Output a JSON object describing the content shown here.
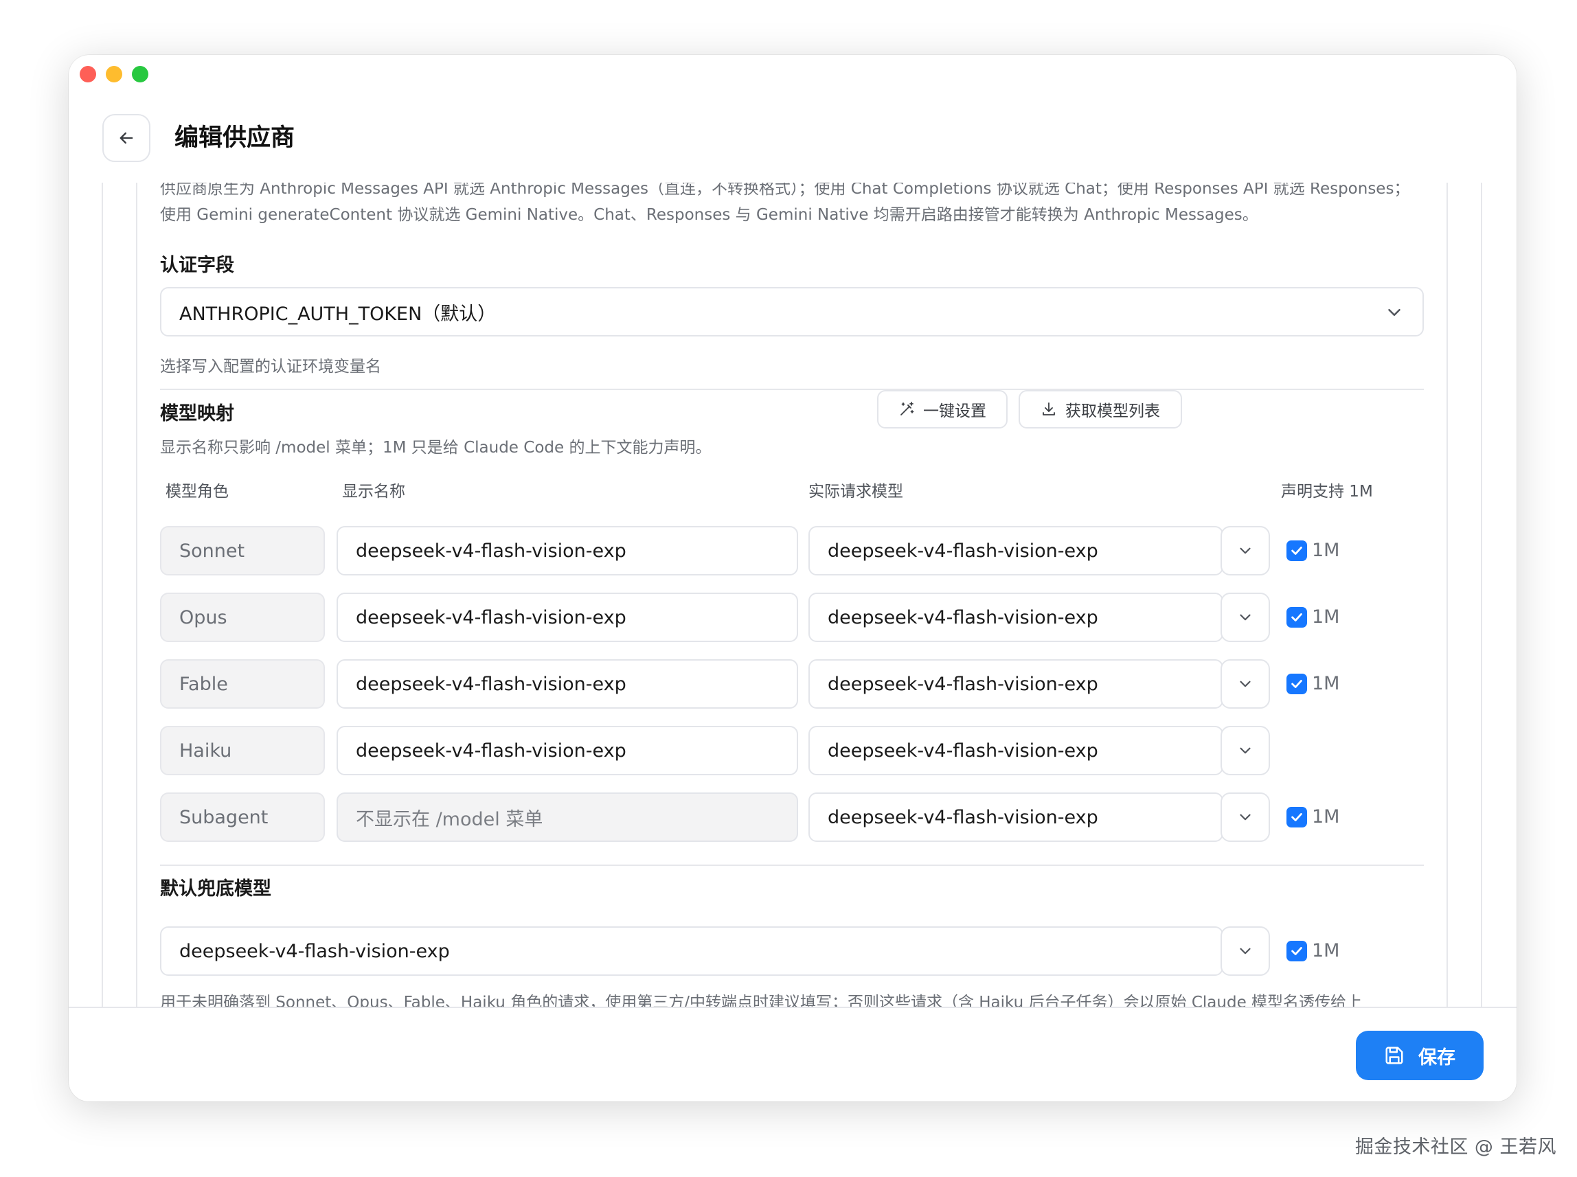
{
  "window": {
    "title": "编辑供应商"
  },
  "intro": {
    "text": "供应商原生为 Anthropic Messages API 就选 Anthropic Messages（直连，不转换格式）；使用 Chat Completions 协议就选 Chat；使用 Responses API 就选 Responses；使用 Gemini generateContent 协议就选 Gemini Native。Chat、Responses 与 Gemini Native 均需开启路由接管才能转换为 Anthropic Messages。"
  },
  "auth": {
    "title": "认证字段",
    "selected": "ANTHROPIC_AUTH_TOKEN（默认）",
    "hint": "选择写入配置的认证环境变量名"
  },
  "mapping": {
    "title": "模型映射",
    "hint": "显示名称只影响 /model 菜单；1M 只是给 Claude Code 的上下文能力声明。",
    "one_click_label": "一键设置",
    "fetch_models_label": "获取模型列表",
    "columns": {
      "role": "模型角色",
      "display_name": "显示名称",
      "actual_model": "实际请求模型",
      "support_1m": "声明支持 1M"
    },
    "rows": [
      {
        "role": "Sonnet",
        "display_name": "deepseek-v4-flash-vision-exp",
        "actual_model": "deepseek-v4-flash-vision-exp",
        "checked": true,
        "check_label": "1M"
      },
      {
        "role": "Opus",
        "display_name": "deepseek-v4-flash-vision-exp",
        "actual_model": "deepseek-v4-flash-vision-exp",
        "checked": true,
        "check_label": "1M"
      },
      {
        "role": "Fable",
        "display_name": "deepseek-v4-flash-vision-exp",
        "actual_model": "deepseek-v4-flash-vision-exp",
        "checked": true,
        "check_label": "1M"
      },
      {
        "role": "Haiku",
        "display_name": "deepseek-v4-flash-vision-exp",
        "actual_model": "deepseek-v4-flash-vision-exp",
        "checked": false,
        "check_label": ""
      },
      {
        "role": "Subagent",
        "display_name_placeholder": "不显示在 /model 菜单",
        "actual_model": "deepseek-v4-flash-vision-exp",
        "checked": true,
        "check_label": "1M"
      }
    ]
  },
  "fallback": {
    "title": "默认兜底模型",
    "model": "deepseek-v4-flash-vision-exp",
    "checked": true,
    "check_label": "1M",
    "hint": "用于未明确落到 Sonnet、Opus、Fable、Haiku 角色的请求，使用第三方/中转端点时建议填写；否则这些请求（含 Haiku 后台子任务）会以原始 Claude 模型名透传给上"
  },
  "footer": {
    "save_label": "保存"
  },
  "watermark": "掘金技术社区 @ 王若风",
  "colors": {
    "accent": "#1e80f5",
    "checkbox": "#1677ff",
    "border": "#e3e5ea",
    "muted_text": "#6b6f76"
  },
  "icons": {
    "back": "arrow-left-icon",
    "chevron": "chevron-down-icon",
    "magic": "magic-wand-icon",
    "download": "download-icon",
    "save": "floppy-disk-icon",
    "check": "checkmark-icon"
  }
}
